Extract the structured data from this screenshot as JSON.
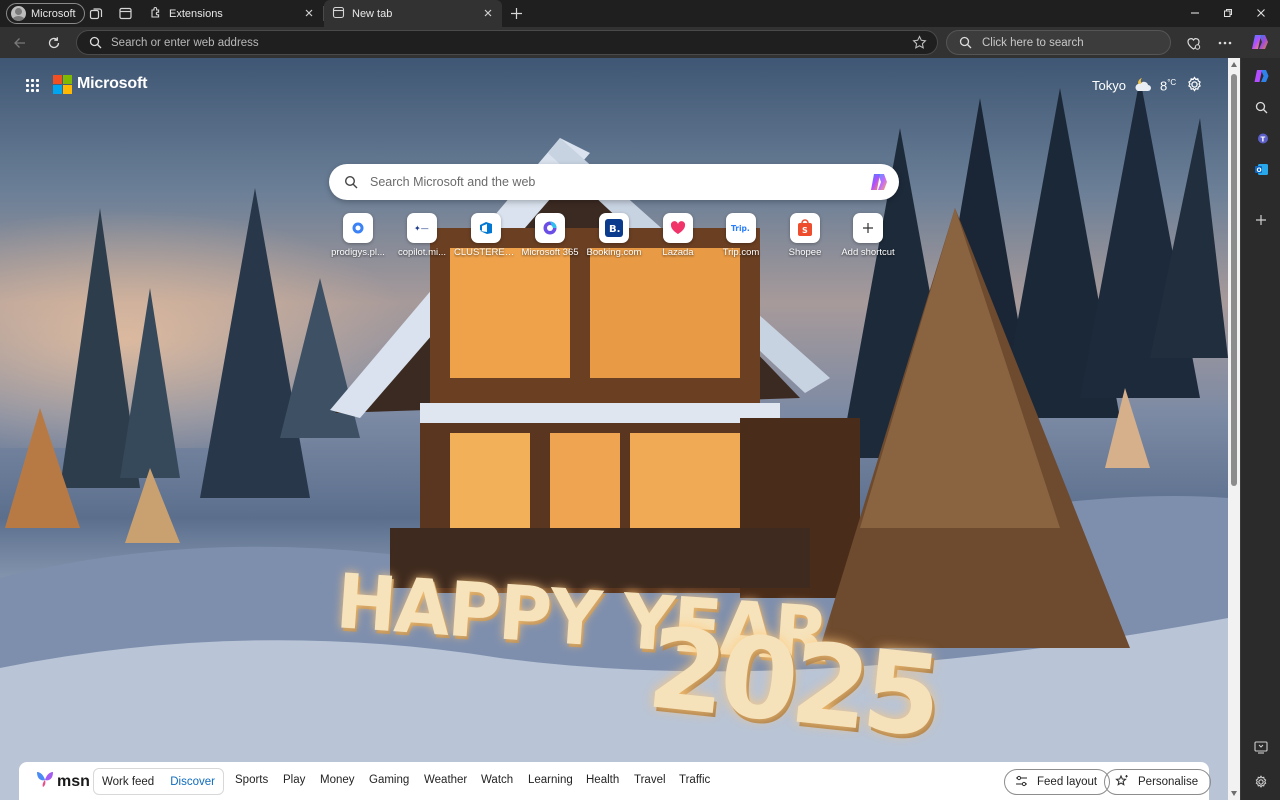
{
  "window": {
    "profile_label": "Microsoft",
    "tabs": [
      {
        "label": "Extensions",
        "active": false
      },
      {
        "label": "New tab",
        "active": true
      }
    ]
  },
  "toolbar": {
    "address_placeholder": "Search or enter web address",
    "search_placeholder": "Click here to search"
  },
  "page": {
    "brand": "Microsoft",
    "weather": {
      "city": "Tokyo",
      "temperature": "8",
      "unit": "°C"
    },
    "search_placeholder": "Search Microsoft and the web",
    "shortcuts": [
      {
        "label": "prodigys.pl...",
        "icon": "prodigys-icon"
      },
      {
        "label": "copilot.mi...",
        "icon": "copilot-app-icon"
      },
      {
        "label": "CLUSTERED ...",
        "icon": "azure-devops-icon"
      },
      {
        "label": "Microsoft 365",
        "icon": "microsoft-365-icon"
      },
      {
        "label": "Booking.com",
        "icon": "booking-icon"
      },
      {
        "label": "Lazada",
        "icon": "lazada-icon"
      },
      {
        "label": "Trip.com",
        "icon": "trip-icon"
      },
      {
        "label": "Shopee",
        "icon": "shopee-icon"
      },
      {
        "label": "Add shortcut",
        "icon": "plus-icon"
      }
    ],
    "background_text": {
      "line1": "HAPPY YEAR",
      "line2": "2025"
    }
  },
  "msn": {
    "logo": "msn",
    "feed_tabs": [
      "Work feed",
      "Discover"
    ],
    "active_feed": "Discover",
    "nav": [
      "Sports",
      "Play",
      "Money",
      "Gaming",
      "Weather",
      "Watch",
      "Learning",
      "Health",
      "Travel",
      "Traffic"
    ],
    "feed_layout": "Feed layout",
    "personalise": "Personalise"
  },
  "colors": {
    "accent": "#0f6cbd",
    "tab_strip": "#1f1f1f",
    "toolbar": "#323232",
    "ms_red": "#f25022",
    "ms_green": "#7fba00",
    "ms_blue": "#00a4ef",
    "ms_yellow": "#ffb900"
  }
}
